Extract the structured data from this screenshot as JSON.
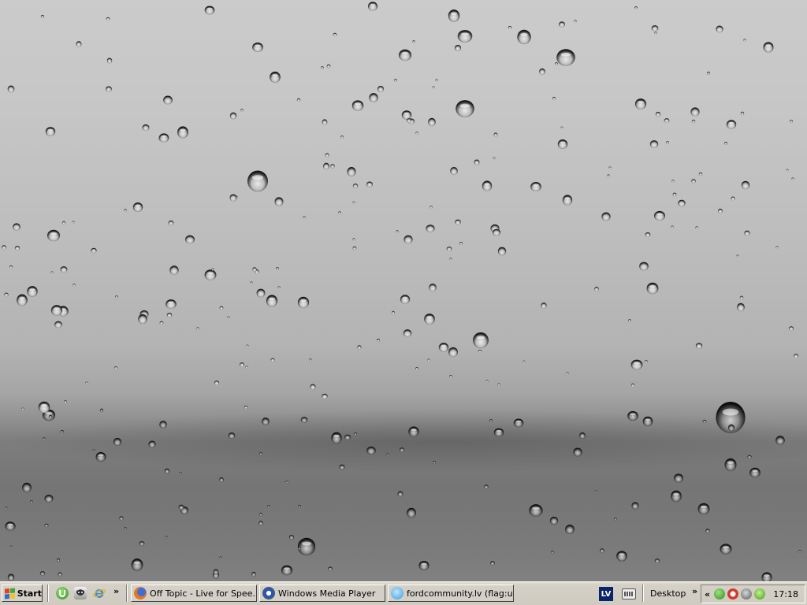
{
  "desktop": {
    "wallpaper": "raindrops-on-glass"
  },
  "taskbar": {
    "start_label": "Start",
    "quick_launch": [
      {
        "icon": "utorrent-icon"
      },
      {
        "icon": "gadget-icon"
      },
      {
        "icon": "internet-explorer-icon"
      }
    ],
    "quick_launch_overflow": "»",
    "tasks": [
      {
        "label": "Off Topic - Live for Spee...",
        "icon": "firefox-icon"
      },
      {
        "label": "Windows Media Player",
        "icon": "windows-media-player-icon"
      },
      {
        "label": "fordcommunity.lv (flag:u...",
        "icon": "chat-client-icon"
      }
    ],
    "language": "LV",
    "toolbar_label": "Desktop",
    "toolbar_overflow": "»",
    "tray_expand": "«",
    "tray_icons": [
      "utorrent-tray-icon",
      "network-alert-tray-icon",
      "media-tray-icon",
      "antivirus-tray-icon"
    ],
    "clock": "17:18"
  },
  "colors": {
    "taskbar_bg": "#d4d0c8",
    "language_bg": "#0a246a",
    "win_red": "#e0441e",
    "win_green": "#4aa33a",
    "win_blue": "#2f6ed1",
    "win_yellow": "#f6c21b"
  }
}
